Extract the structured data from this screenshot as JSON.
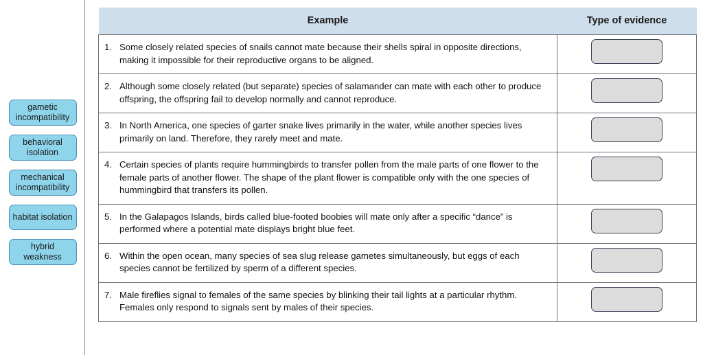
{
  "colors": {
    "chip_fill": "#8ed5ec",
    "chip_border": "#4a8fb5",
    "header_fill": "#cfdeec",
    "dropzone_fill": "#dcdcdc",
    "dropzone_border": "#3c3f55",
    "cell_border": "#6f7173",
    "panel_divider": "#888a8c"
  },
  "chip_panel": {
    "chips": [
      {
        "label": "gametic incompatibility",
        "name": "chip-gametic-incompatibility"
      },
      {
        "label": "behavioral isolation",
        "name": "chip-behavioral-isolation"
      },
      {
        "label": "mechanical incompatibility",
        "name": "chip-mechanical-incompatibility"
      },
      {
        "label": "habitat isolation",
        "name": "chip-habitat-isolation"
      },
      {
        "label": "hybrid weakness",
        "name": "chip-hybrid-weakness"
      }
    ]
  },
  "table": {
    "headers": {
      "example": "Example",
      "evidence": "Type of evidence"
    },
    "rows": [
      {
        "number": "1.",
        "text": "Some closely related species of snails cannot mate because their shells spiral in opposite directions, making it impossible for their reproductive organs to be aligned.",
        "answer": ""
      },
      {
        "number": "2.",
        "text": "Although some closely related (but separate) species of salamander can mate with each other to produce offspring, the offspring fail to develop normally and cannot reproduce.",
        "answer": ""
      },
      {
        "number": "3.",
        "text": "In North America, one species of garter snake lives primarily in the water, while another species lives primarily on land. Therefore, they rarely meet and mate.",
        "answer": ""
      },
      {
        "number": "4.",
        "text": "Certain species of plants require hummingbirds to transfer pollen from the male parts of one flower to the female parts of another flower. The shape of the plant flower is compatible only with the one species of hummingbird that transfers its pollen.",
        "answer": ""
      },
      {
        "number": "5.",
        "text": "In the Galapagos Islands, birds called blue-footed boobies will mate only after a specific “dance” is performed where a potential mate displays bright blue feet.",
        "answer": ""
      },
      {
        "number": "6.",
        "text": "Within the open ocean, many species of sea slug release gametes simultaneously, but eggs of each species cannot be fertilized by sperm of a different species.",
        "answer": ""
      },
      {
        "number": "7.",
        "text": "Male fireflies signal to females of the same species by blinking their tail lights at a particular rhythm. Females only respond to signals sent by males of their species.",
        "answer": ""
      }
    ]
  }
}
